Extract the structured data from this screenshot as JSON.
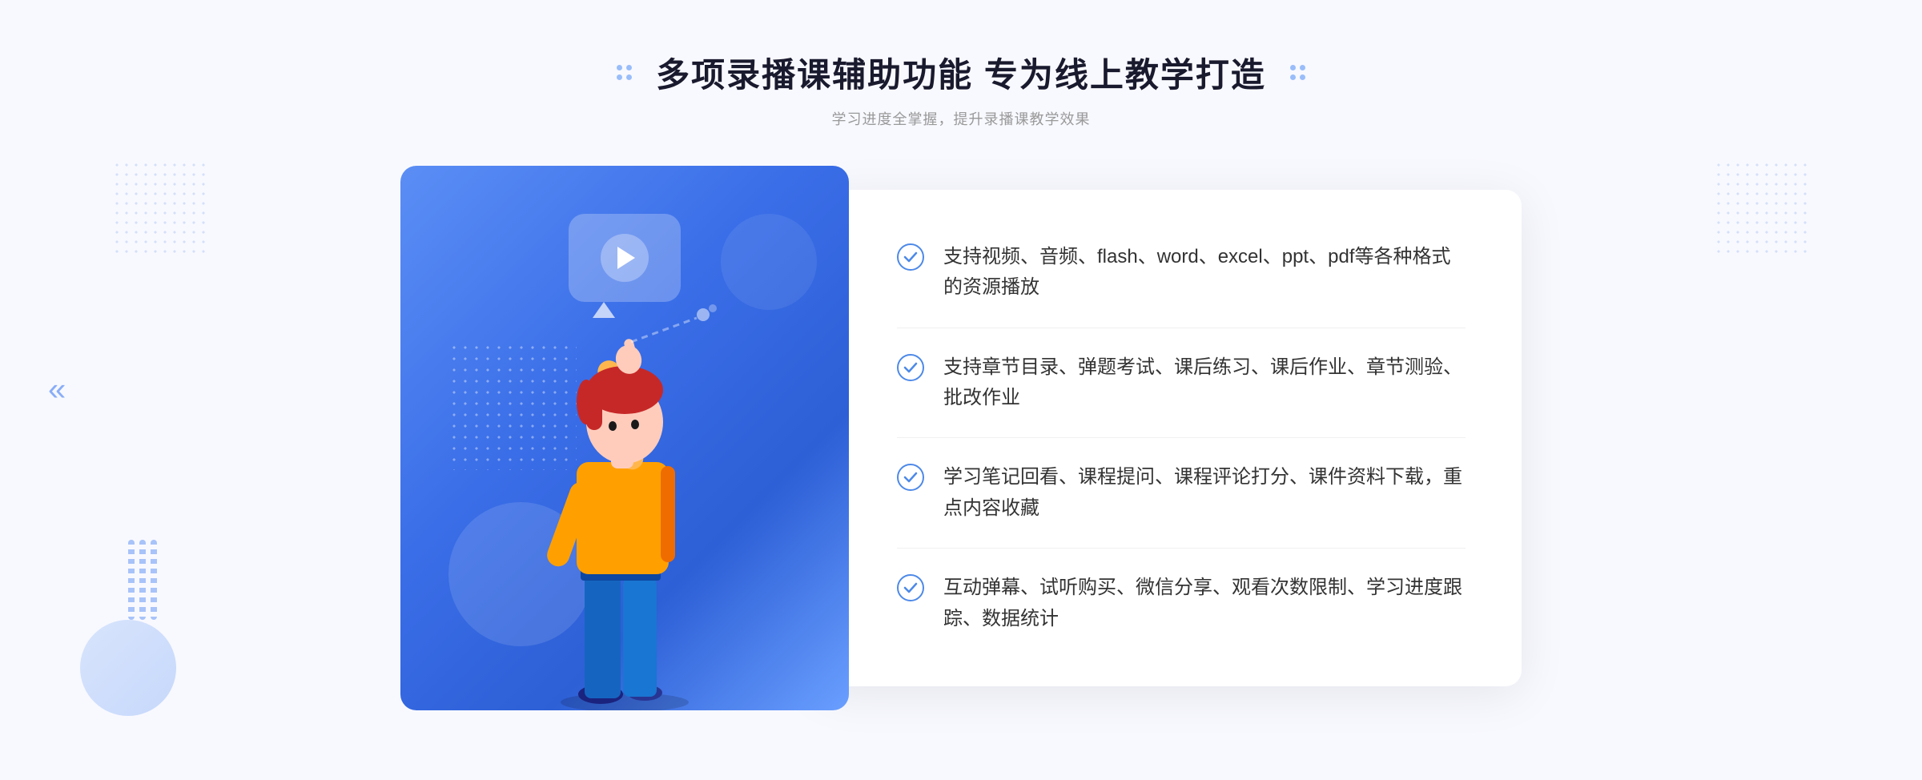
{
  "header": {
    "title": "多项录播课辅助功能 专为线上教学打造",
    "subtitle": "学习进度全掌握，提升录播课教学效果"
  },
  "features": [
    {
      "id": 1,
      "text": "支持视频、音频、flash、word、excel、ppt、pdf等各种格式的资源播放"
    },
    {
      "id": 2,
      "text": "支持章节目录、弹题考试、课后练习、课后作业、章节测验、批改作业"
    },
    {
      "id": 3,
      "text": "学习笔记回看、课程提问、课程评论打分、课件资料下载，重点内容收藏"
    },
    {
      "id": 4,
      "text": "互动弹幕、试听购买、微信分享、观看次数限制、学习进度跟踪、数据统计"
    }
  ],
  "decorations": {
    "left_arrow": "«",
    "play_label": "play"
  }
}
